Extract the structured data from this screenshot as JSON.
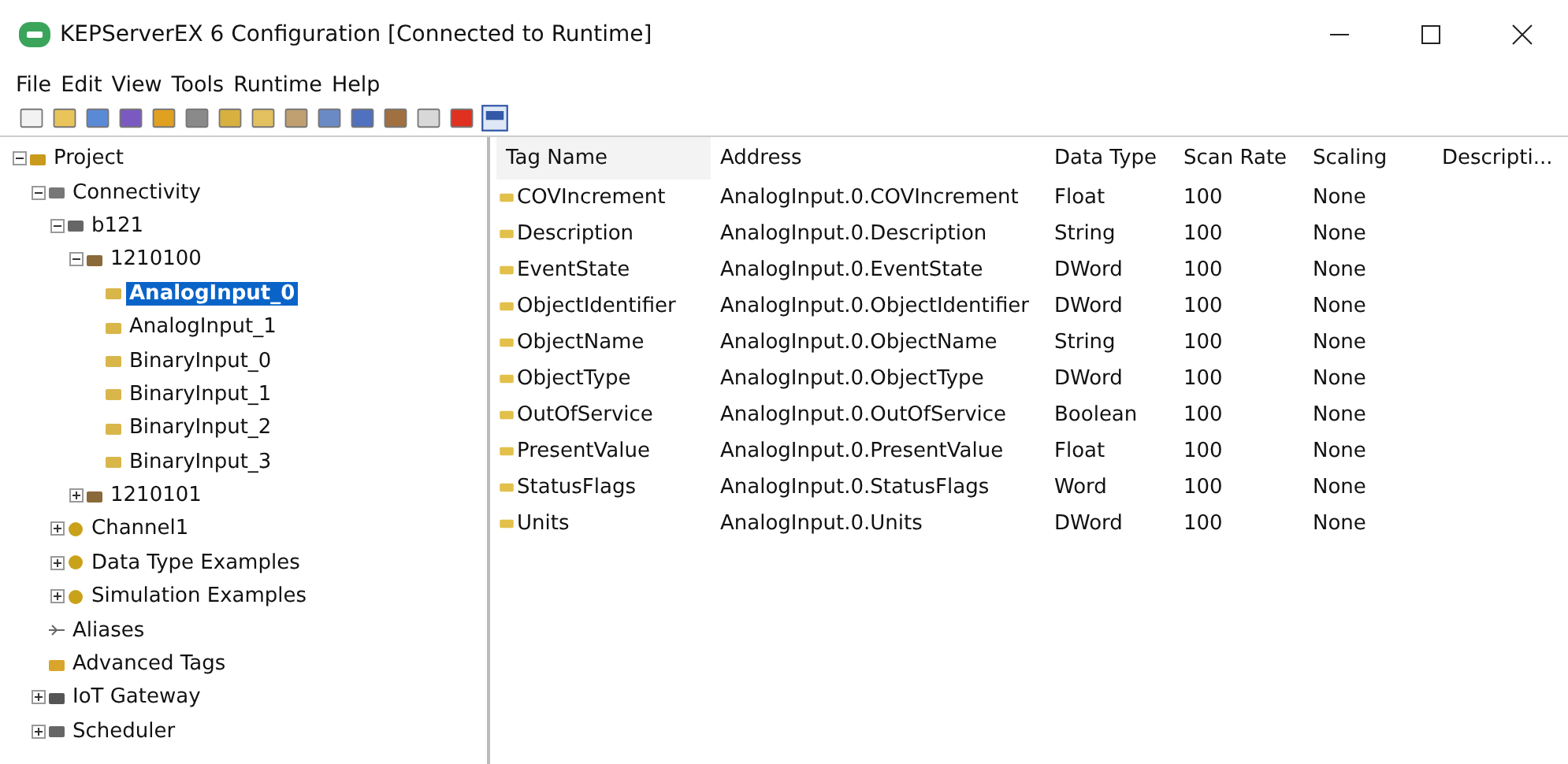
{
  "window": {
    "title": "KEPServerEX 6 Configuration [Connected to Runtime]"
  },
  "menu": [
    "File",
    "Edit",
    "View",
    "Tools",
    "Runtime",
    "Help"
  ],
  "tree": [
    {
      "label": "Project",
      "kind": "project",
      "expanded": true,
      "selected": false,
      "children": [
        {
          "label": "Connectivity",
          "kind": "connectivity",
          "expanded": true,
          "selected": false,
          "children": [
            {
              "label": "b121",
              "kind": "channel",
              "expanded": true,
              "selected": false,
              "children": [
                {
                  "label": "1210100",
                  "kind": "device",
                  "expanded": true,
                  "selected": false,
                  "children": [
                    {
                      "label": "AnalogInput_0",
                      "kind": "group",
                      "selected": true
                    },
                    {
                      "label": "AnalogInput_1",
                      "kind": "group",
                      "selected": false
                    },
                    {
                      "label": "BinaryInput_0",
                      "kind": "group",
                      "selected": false
                    },
                    {
                      "label": "BinaryInput_1",
                      "kind": "group",
                      "selected": false
                    },
                    {
                      "label": "BinaryInput_2",
                      "kind": "group",
                      "selected": false
                    },
                    {
                      "label": "BinaryInput_3",
                      "kind": "group",
                      "selected": false
                    }
                  ]
                },
                {
                  "label": "1210101",
                  "kind": "device",
                  "expanded": false,
                  "selected": false
                }
              ]
            },
            {
              "label": "Channel1",
              "kind": "gear",
              "expanded": false,
              "selected": false
            },
            {
              "label": "Data Type Examples",
              "kind": "gear",
              "expanded": false,
              "selected": false
            },
            {
              "label": "Simulation Examples",
              "kind": "gear",
              "expanded": false,
              "selected": false
            }
          ]
        },
        {
          "label": "Aliases",
          "kind": "alias",
          "selected": false
        },
        {
          "label": "Advanced Tags",
          "kind": "advanced",
          "selected": false
        },
        {
          "label": "IoT Gateway",
          "kind": "iot",
          "expanded": false,
          "selected": false
        },
        {
          "label": "Scheduler",
          "kind": "scheduler",
          "expanded": false,
          "selected": false
        }
      ]
    }
  ],
  "table": {
    "columns": [
      "Tag Name",
      "Address",
      "Data Type",
      "Scan Rate",
      "Scaling",
      "Descripti..."
    ],
    "rows": [
      [
        "COVIncrement",
        "AnalogInput.0.COVIncrement",
        "Float",
        "100",
        "None"
      ],
      [
        "Description",
        "AnalogInput.0.Description",
        "String",
        "100",
        "None"
      ],
      [
        "EventState",
        "AnalogInput.0.EventState",
        "DWord",
        "100",
        "None"
      ],
      [
        "ObjectIdentifier",
        "AnalogInput.0.ObjectIdentifier",
        "DWord",
        "100",
        "None"
      ],
      [
        "ObjectName",
        "AnalogInput.0.ObjectName",
        "String",
        "100",
        "None"
      ],
      [
        "ObjectType",
        "AnalogInput.0.ObjectType",
        "DWord",
        "100",
        "None"
      ],
      [
        "OutOfService",
        "AnalogInput.0.OutOfService",
        "Boolean",
        "100",
        "None"
      ],
      [
        "PresentValue",
        "AnalogInput.0.PresentValue",
        "Float",
        "100",
        "None"
      ],
      [
        "StatusFlags",
        "AnalogInput.0.StatusFlags",
        "Word",
        "100",
        "None"
      ],
      [
        "Units",
        "AnalogInput.0.Units",
        "DWord",
        "100",
        "None"
      ]
    ]
  }
}
